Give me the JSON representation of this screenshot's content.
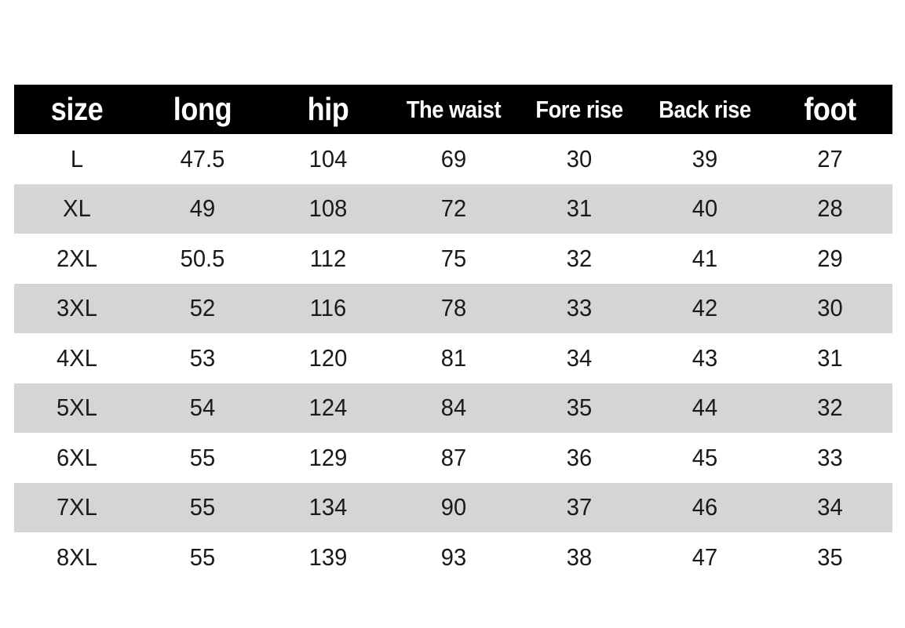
{
  "table": {
    "header_background": "#000000",
    "header_text_color": "#ffffff",
    "stripe_color": "#d5d5d5",
    "row_color": "#ffffff",
    "columns": [
      {
        "key": "size",
        "label": "size",
        "emphasis": "wide"
      },
      {
        "key": "long",
        "label": "long",
        "emphasis": "wide"
      },
      {
        "key": "hip",
        "label": "hip",
        "emphasis": "wide"
      },
      {
        "key": "waist",
        "label": "The waist",
        "emphasis": "narrow"
      },
      {
        "key": "fore",
        "label": "Fore rise",
        "emphasis": "narrow"
      },
      {
        "key": "back",
        "label": "Back rise",
        "emphasis": "narrow"
      },
      {
        "key": "foot",
        "label": "foot",
        "emphasis": "wide"
      }
    ],
    "rows": [
      {
        "size": "L",
        "long": "47.5",
        "hip": "104",
        "waist": "69",
        "fore": "30",
        "back": "39",
        "foot": "27"
      },
      {
        "size": "XL",
        "long": "49",
        "hip": "108",
        "waist": "72",
        "fore": "31",
        "back": "40",
        "foot": "28"
      },
      {
        "size": "2XL",
        "long": "50.5",
        "hip": "112",
        "waist": "75",
        "fore": "32",
        "back": "41",
        "foot": "29"
      },
      {
        "size": "3XL",
        "long": "52",
        "hip": "116",
        "waist": "78",
        "fore": "33",
        "back": "42",
        "foot": "30"
      },
      {
        "size": "4XL",
        "long": "53",
        "hip": "120",
        "waist": "81",
        "fore": "34",
        "back": "43",
        "foot": "31"
      },
      {
        "size": "5XL",
        "long": "54",
        "hip": "124",
        "waist": "84",
        "fore": "35",
        "back": "44",
        "foot": "32"
      },
      {
        "size": "6XL",
        "long": "55",
        "hip": "129",
        "waist": "87",
        "fore": "36",
        "back": "45",
        "foot": "33"
      },
      {
        "size": "7XL",
        "long": "55",
        "hip": "134",
        "waist": "90",
        "fore": "37",
        "back": "46",
        "foot": "34"
      },
      {
        "size": "8XL",
        "long": "55",
        "hip": "139",
        "waist": "93",
        "fore": "38",
        "back": "47",
        "foot": "35"
      }
    ]
  }
}
